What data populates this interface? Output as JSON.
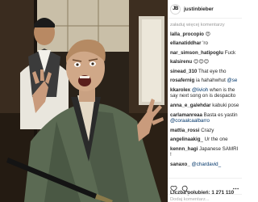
{
  "post": {
    "username": "justinbieber",
    "avatar_text": "JB"
  },
  "comments": {
    "load_more": "załaduj więcej komentarzy",
    "items": [
      {
        "user": "lalla_procopio",
        "text": " 😍"
      },
      {
        "user": "ellanatiddhar",
        "text": " 'ro"
      },
      {
        "user": "nar_simson_hatipoglu",
        "text": " Fuck"
      },
      {
        "user": "kalsirenu",
        "text": " 😊😊😊"
      },
      {
        "user": "sinead_310",
        "text": " That eye tho"
      },
      {
        "user": "rosafernig",
        "text": " ia hahahwhut ",
        "mention": "@se"
      },
      {
        "user": "kkarolex",
        "text": " ",
        "mention": "@livioh",
        "text2": " when is the say next song on is despacito"
      },
      {
        "user": "anna_e_galehdar",
        "text": " kabuki pose"
      },
      {
        "user": "carlamanreaa",
        "text": " Basta es yastin ",
        "mention": "@coraalcaalbarro"
      },
      {
        "user": "mattia_rossi",
        "text": " Crazy"
      },
      {
        "user": "angelinaakig",
        "text": "_ Ur the one"
      },
      {
        "user": "kennn_hagi",
        "text": " Japanese SAMRI !"
      },
      {
        "user": "sanaxo_",
        "text": " ",
        "mention": "@chardavid_"
      }
    ]
  },
  "footer": {
    "likes": "Liczba polubień: 1 271 110",
    "add_comment_placeholder": "Dodaj komentarz..."
  },
  "icons": [
    "avatar",
    "heart-icon",
    "comment-icon",
    "more-icon"
  ]
}
